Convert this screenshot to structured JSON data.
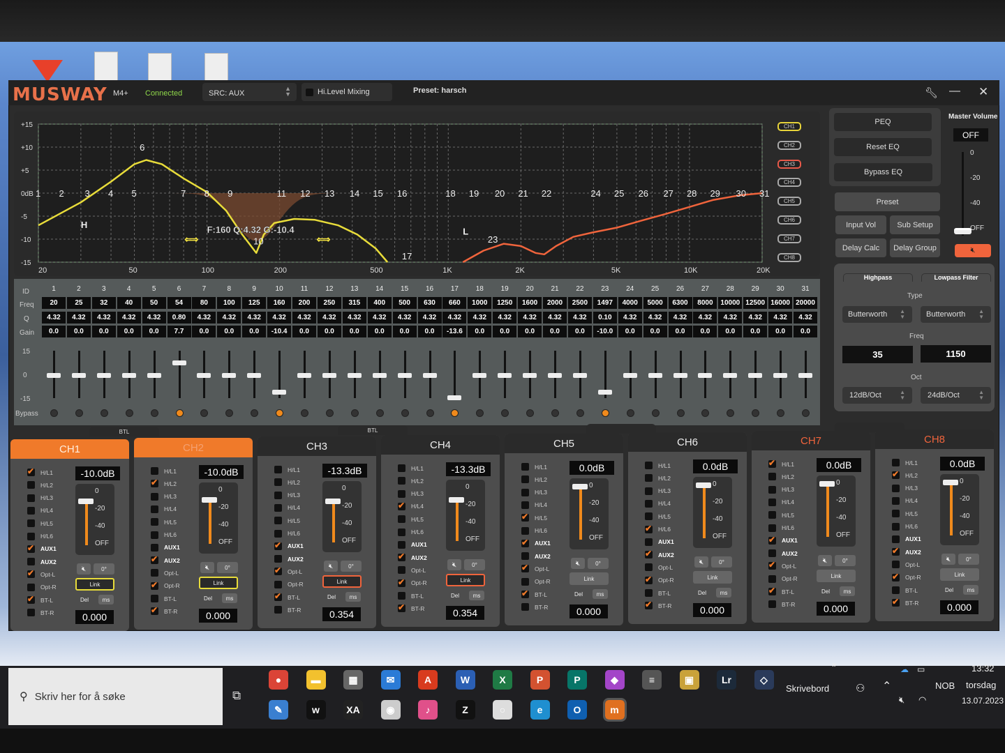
{
  "app": {
    "brand": "MUSWAY",
    "model": "M4+",
    "status": "Connected",
    "source": "SRC: AUX",
    "hi_level_mixing": "Hi.Level Mixing",
    "hi_level_checked": false,
    "preset": "Preset: harsch"
  },
  "channel_selectors": [
    {
      "label": "CH1",
      "color": "#e8d43a"
    },
    {
      "label": "CH2",
      "color": "#aaaaaa"
    },
    {
      "label": "CH3",
      "color": "#e85a4a"
    },
    {
      "label": "CH4",
      "color": "#aaaaaa"
    },
    {
      "label": "CH5",
      "color": "#aaaaaa"
    },
    {
      "label": "CH6",
      "color": "#aaaaaa"
    },
    {
      "label": "CH7",
      "color": "#aaaaaa"
    },
    {
      "label": "CH8",
      "color": "#aaaaaa"
    }
  ],
  "buttons": {
    "peq": "PEQ",
    "reset_eq": "Reset EQ",
    "bypass_eq": "Bypass EQ",
    "preset": "Preset",
    "input_vol": "Input Vol",
    "sub_setup": "Sub Setup",
    "delay_calc": "Delay Calc",
    "delay_group": "Delay Group"
  },
  "master": {
    "title": "Master Volume",
    "value": "OFF",
    "ticks": [
      "0",
      "-20",
      "-40",
      "OFF"
    ]
  },
  "filters": {
    "highpass": "Highpass",
    "lowpass": "Lowpass Filter",
    "type_label": "Type",
    "freq_label": "Freq",
    "oct_label": "Oct",
    "hp_type": "Butterworth",
    "lp_type": "Butterworth",
    "hp_freq": "35",
    "lp_freq": "1150",
    "hp_oct": "12dB/Oct",
    "lp_oct": "24dB/Oct"
  },
  "eq": {
    "row_labels": {
      "id": "ID",
      "freq": "Freq",
      "q": "Q",
      "gain": "Gain",
      "bypass": "Bypass"
    },
    "fader_ticks": [
      "15",
      "0",
      "-15"
    ],
    "bands": [
      {
        "id": "1",
        "freq": "20",
        "q": "4.32",
        "gain": "0.0"
      },
      {
        "id": "2",
        "freq": "25",
        "q": "4.32",
        "gain": "0.0"
      },
      {
        "id": "3",
        "freq": "32",
        "q": "4.32",
        "gain": "0.0"
      },
      {
        "id": "4",
        "freq": "40",
        "q": "4.32",
        "gain": "0.0"
      },
      {
        "id": "5",
        "freq": "50",
        "q": "4.32",
        "gain": "0.0"
      },
      {
        "id": "6",
        "freq": "54",
        "q": "0.80",
        "gain": "7.7"
      },
      {
        "id": "7",
        "freq": "80",
        "q": "4.32",
        "gain": "0.0"
      },
      {
        "id": "8",
        "freq": "100",
        "q": "4.32",
        "gain": "0.0"
      },
      {
        "id": "9",
        "freq": "125",
        "q": "4.32",
        "gain": "0.0"
      },
      {
        "id": "10",
        "freq": "160",
        "q": "4.32",
        "gain": "-10.4"
      },
      {
        "id": "11",
        "freq": "200",
        "q": "4.32",
        "gain": "0.0"
      },
      {
        "id": "12",
        "freq": "250",
        "q": "4.32",
        "gain": "0.0"
      },
      {
        "id": "13",
        "freq": "315",
        "q": "4.32",
        "gain": "0.0"
      },
      {
        "id": "14",
        "freq": "400",
        "q": "4.32",
        "gain": "0.0"
      },
      {
        "id": "15",
        "freq": "500",
        "q": "4.32",
        "gain": "0.0"
      },
      {
        "id": "16",
        "freq": "630",
        "q": "4.32",
        "gain": "0.0"
      },
      {
        "id": "17",
        "freq": "660",
        "q": "4.32",
        "gain": "-13.6"
      },
      {
        "id": "18",
        "freq": "1000",
        "q": "4.32",
        "gain": "0.0"
      },
      {
        "id": "19",
        "freq": "1250",
        "q": "4.32",
        "gain": "0.0"
      },
      {
        "id": "20",
        "freq": "1600",
        "q": "4.32",
        "gain": "0.0"
      },
      {
        "id": "21",
        "freq": "2000",
        "q": "4.32",
        "gain": "0.0"
      },
      {
        "id": "22",
        "freq": "2500",
        "q": "4.32",
        "gain": "0.0"
      },
      {
        "id": "23",
        "freq": "1497",
        "q": "0.10",
        "gain": "-10.0"
      },
      {
        "id": "24",
        "freq": "4000",
        "q": "4.32",
        "gain": "0.0"
      },
      {
        "id": "25",
        "freq": "5000",
        "q": "4.32",
        "gain": "0.0"
      },
      {
        "id": "26",
        "freq": "6300",
        "q": "4.32",
        "gain": "0.0"
      },
      {
        "id": "27",
        "freq": "8000",
        "q": "4.32",
        "gain": "0.0"
      },
      {
        "id": "28",
        "freq": "10000",
        "q": "4.32",
        "gain": "0.0"
      },
      {
        "id": "29",
        "freq": "12500",
        "q": "4.32",
        "gain": "0.0"
      },
      {
        "id": "30",
        "freq": "16000",
        "q": "4.32",
        "gain": "0.0"
      },
      {
        "id": "31",
        "freq": "20000",
        "q": "4.32",
        "gain": "0.0"
      }
    ]
  },
  "chart_data": {
    "type": "line",
    "title": "",
    "xscale": "log",
    "xlim": [
      20,
      20000
    ],
    "ylim": [
      -15,
      15
    ],
    "x_ticks": [
      "20",
      "50",
      "100",
      "200",
      "500",
      "1K",
      "2K",
      "5K",
      "10K",
      "20K"
    ],
    "x_tick_values": [
      20,
      50,
      100,
      200,
      500,
      1000,
      2000,
      5000,
      10000,
      20000
    ],
    "y_ticks": [
      "+15",
      "+10",
      "+5",
      "0dB",
      "-5",
      "-10",
      "-15"
    ],
    "y_tick_values": [
      15,
      10,
      5,
      0,
      -5,
      -10,
      -15
    ],
    "grid": true,
    "tooltip": "F:160 Q:4.32 G:-10.4",
    "hp_marker": "H",
    "lp_marker": "L",
    "selected_band": 10,
    "series": [
      {
        "name": "CH1",
        "color": "#e8dc3a",
        "points": [
          [
            20,
            -7
          ],
          [
            30,
            -2
          ],
          [
            40,
            2.5
          ],
          [
            50,
            6.3
          ],
          [
            56,
            7.2
          ],
          [
            65,
            6.3
          ],
          [
            80,
            3.2
          ],
          [
            100,
            0.2
          ],
          [
            120,
            -3.8
          ],
          [
            140,
            -9
          ],
          [
            160,
            -13
          ],
          [
            172,
            -9
          ],
          [
            190,
            -6.5
          ],
          [
            230,
            -5.6
          ],
          [
            280,
            -5.8
          ],
          [
            350,
            -7
          ],
          [
            420,
            -9
          ],
          [
            500,
            -12
          ],
          [
            560,
            -15
          ]
        ]
      },
      {
        "name": "CH3",
        "color": "#f0643c",
        "points": [
          [
            1150,
            -15
          ],
          [
            1400,
            -12.5
          ],
          [
            1700,
            -11
          ],
          [
            2000,
            -11.5
          ],
          [
            2300,
            -13
          ],
          [
            2500,
            -13.3
          ],
          [
            2800,
            -11.5
          ],
          [
            3300,
            -9.5
          ],
          [
            4000,
            -8.5
          ],
          [
            5000,
            -7.5
          ],
          [
            6300,
            -6
          ],
          [
            8000,
            -4.5
          ],
          [
            10000,
            -3
          ],
          [
            12500,
            -1.5
          ],
          [
            16000,
            -0.5
          ],
          [
            20000,
            0
          ]
        ]
      }
    ]
  },
  "strip_labels": {
    "link": "Link",
    "del": "Del",
    "ms": "ms",
    "phase": "0°",
    "ticks": [
      "0",
      "-20",
      "-40",
      "OFF"
    ],
    "groups": [
      "BTL",
      "BTL",
      "",
      ""
    ]
  },
  "inputs": [
    "H/L1",
    "H/L2",
    "H/L3",
    "H/L4",
    "H/L5",
    "H/L6",
    "AUX1",
    "AUX2",
    "Opt-L",
    "Opt-R",
    "BT-L",
    "BT-R"
  ],
  "channels": [
    {
      "name": "CH1",
      "active": true,
      "title_color": "#ffeedd",
      "level": "-10.0dB",
      "level_db": -10,
      "link_color": "#e8dc3a",
      "delay": "0.000",
      "checked": [
        "H/L1",
        "AUX1",
        "Opt-L",
        "BT-L"
      ]
    },
    {
      "name": "CH2",
      "active": true,
      "title_color": "#f5a070",
      "level": "-10.0dB",
      "level_db": -10,
      "link_color": "#e8dc3a",
      "delay": "0.000",
      "checked": [
        "H/L2",
        "AUX2",
        "Opt-R",
        "BT-R"
      ]
    },
    {
      "name": "CH3",
      "active": false,
      "title_color": "#eeeeee",
      "level": "-13.3dB",
      "level_db": -13.3,
      "link_color": "#f0643c",
      "delay": "0.354",
      "checked": [
        "AUX1",
        "Opt-L",
        "BT-L"
      ]
    },
    {
      "name": "CH4",
      "active": false,
      "title_color": "#eeeeee",
      "level": "-13.3dB",
      "level_db": -13.3,
      "link_color": "#f0643c",
      "delay": "0.354",
      "checked": [
        "H/L4",
        "AUX2",
        "Opt-R",
        "BT-R"
      ]
    },
    {
      "name": "CH5",
      "active": false,
      "title_color": "#eeeeee",
      "level": "0.0dB",
      "level_db": 0,
      "link_color": "",
      "delay": "0.000",
      "checked": [
        "H/L5",
        "AUX1",
        "Opt-L",
        "BT-L"
      ]
    },
    {
      "name": "CH6",
      "active": false,
      "title_color": "#eeeeee",
      "level": "0.0dB",
      "level_db": 0,
      "link_color": "",
      "delay": "0.000",
      "checked": [
        "H/L6",
        "AUX2",
        "Opt-R",
        "BT-R"
      ]
    },
    {
      "name": "CH7",
      "active": false,
      "title_color": "#f0643c",
      "level": "0.0dB",
      "level_db": 0,
      "link_color": "",
      "delay": "0.000",
      "checked": [
        "H/L1",
        "AUX1",
        "Opt-L",
        "BT-L"
      ]
    },
    {
      "name": "CH8",
      "active": false,
      "title_color": "#f0643c",
      "level": "0.0dB",
      "level_db": 0,
      "link_color": "",
      "delay": "0.000",
      "checked": [
        "H/L2",
        "AUX2",
        "Opt-R",
        "BT-R"
      ]
    }
  ],
  "taskbar": {
    "search_placeholder": "Skriv her for å søke",
    "desktop_label": "Skrivebord",
    "overflow": "»",
    "language": "NOB",
    "time": "13:32",
    "day": "torsdag",
    "date": "13.07.2023",
    "apps": [
      {
        "name": "chrome",
        "glyph": "●",
        "color": "#db4437"
      },
      {
        "name": "file-explorer",
        "glyph": "▬",
        "color": "#f2c12e"
      },
      {
        "name": "store",
        "glyph": "▦",
        "color": "#666"
      },
      {
        "name": "mail",
        "glyph": "✉",
        "color": "#2b7bd6"
      },
      {
        "name": "acrobat",
        "glyph": "A",
        "color": "#d83b1e"
      },
      {
        "name": "word",
        "glyph": "W",
        "color": "#2b5fb4"
      },
      {
        "name": "excel",
        "glyph": "X",
        "color": "#1f7a45"
      },
      {
        "name": "powerpoint",
        "glyph": "P",
        "color": "#d35230"
      },
      {
        "name": "publisher",
        "glyph": "P",
        "color": "#077568"
      },
      {
        "name": "firefox",
        "glyph": "◆",
        "color": "#a345c8"
      },
      {
        "name": "app-gray",
        "glyph": "≡",
        "color": "#555"
      },
      {
        "name": "photos",
        "glyph": "▣",
        "color": "#c9a23a"
      },
      {
        "name": "lightroom",
        "glyph": "Lr",
        "color": "#1c2a3a"
      },
      {
        "name": "app-diamond",
        "glyph": "◇",
        "color": "#2a3a5a"
      },
      {
        "name": "paint",
        "glyph": "✎",
        "color": "#3a7fd0"
      },
      {
        "name": "app-w",
        "glyph": "w",
        "color": "#111"
      },
      {
        "name": "app-xa",
        "glyph": "XA",
        "color": "#222"
      },
      {
        "name": "app-circle",
        "glyph": "◉",
        "color": "#ccc"
      },
      {
        "name": "itunes",
        "glyph": "♪",
        "color": "#e0508a"
      },
      {
        "name": "zoom-z",
        "glyph": "Z",
        "color": "#111"
      },
      {
        "name": "app-white",
        "glyph": "○",
        "color": "#ddd"
      },
      {
        "name": "edge",
        "glyph": "e",
        "color": "#1f8fd0"
      },
      {
        "name": "outlook",
        "glyph": "O",
        "color": "#0f5fb0"
      },
      {
        "name": "musway",
        "glyph": "m",
        "color": "#e07020"
      }
    ]
  }
}
